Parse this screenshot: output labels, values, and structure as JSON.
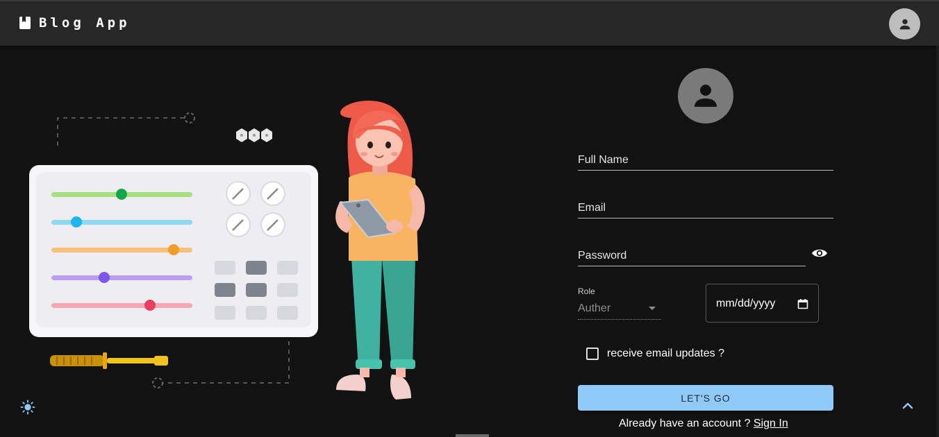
{
  "appbar": {
    "title": "Blog App",
    "brand_icon": "book-icon",
    "avatar_icon": "person-icon"
  },
  "illustration": {
    "description_icon": "illustration-girl-with-tablet"
  },
  "form": {
    "avatar_icon": "person-icon",
    "full_name_placeholder": "Full Name",
    "email_placeholder": "Email",
    "password_placeholder": "Password",
    "password_toggle_icon": "eye-icon",
    "role": {
      "label": "Role",
      "selected": "Auther"
    },
    "date": {
      "placeholder": "mm/dd/yyyy"
    },
    "checkbox_label": "receive email updates ?",
    "submit_label": "LET'S GO",
    "signin_prompt": "Already have an account ?",
    "signin_link": "Sign In"
  },
  "theme_toggle_icon": "sun-icon",
  "scroll_top_icon": "chevron-up-icon",
  "colors": {
    "background": "#121212",
    "appbar": "#272727",
    "primary_button": "#90caf9",
    "avatar_bg": "#7a7a7a",
    "sun_icon": "#90caf9"
  }
}
